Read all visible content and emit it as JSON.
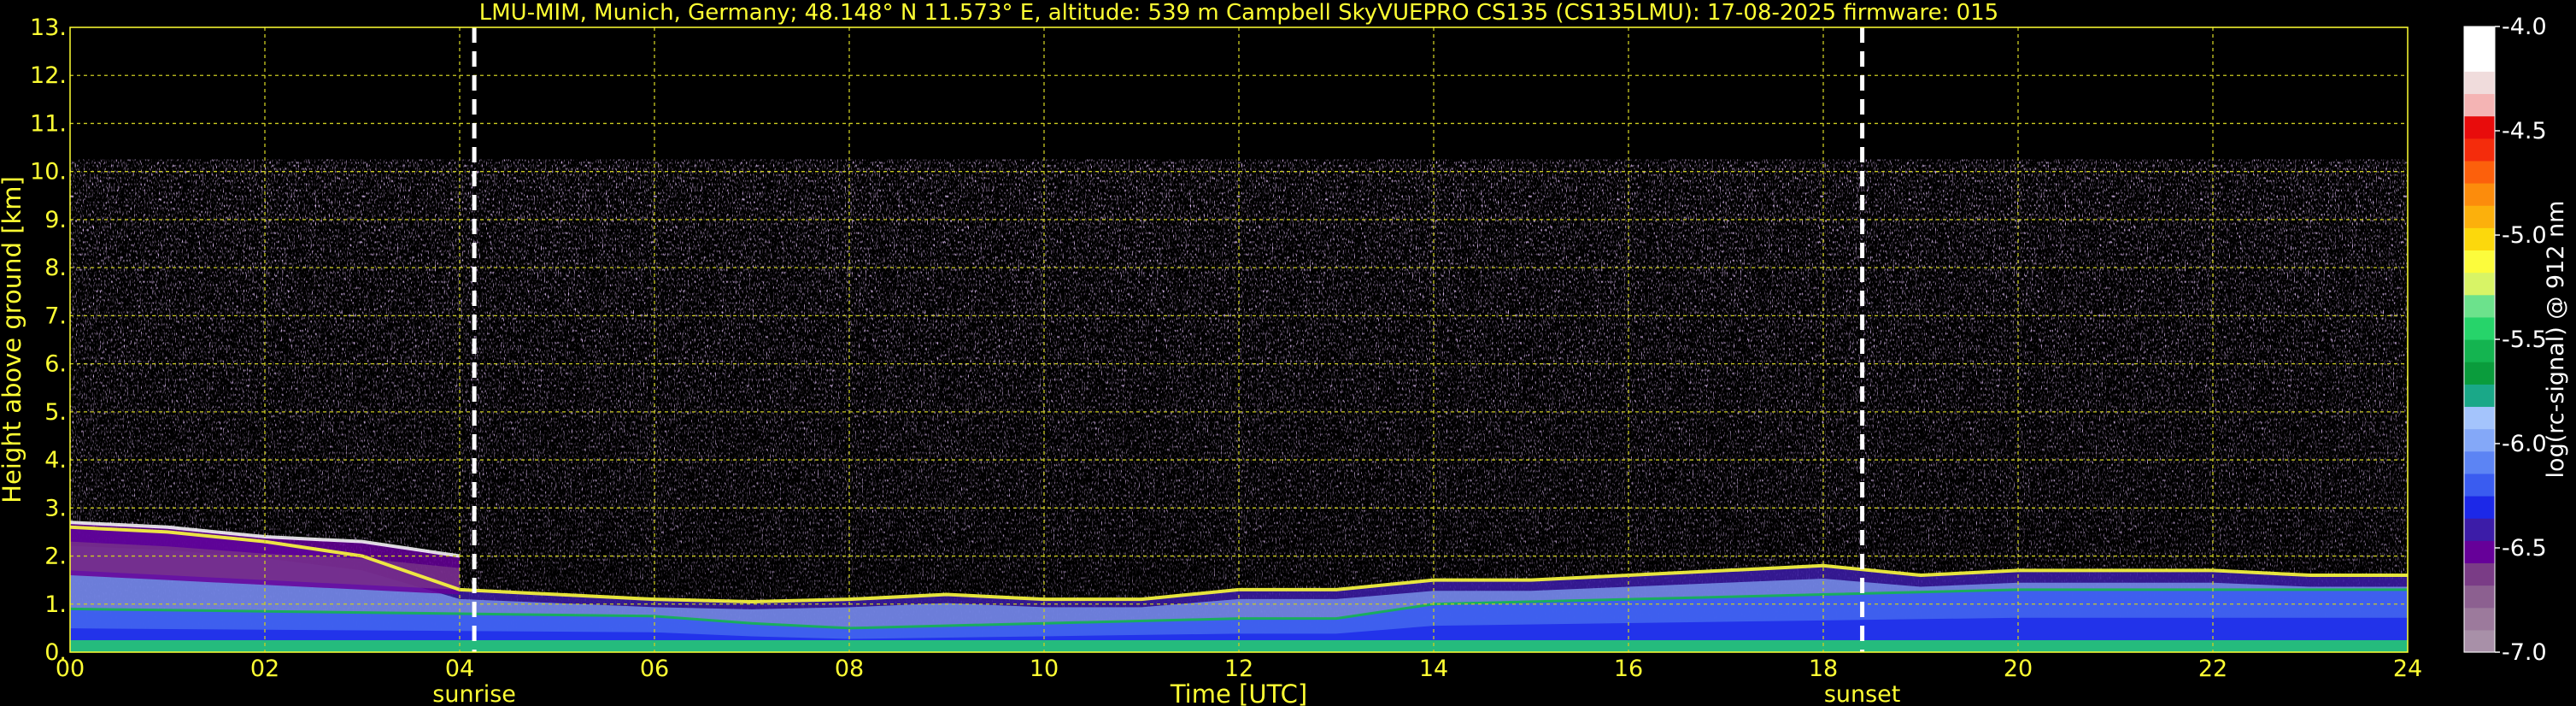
{
  "chart_data": {
    "type": "heatmap",
    "title": "LMU-MIM, Munich, Germany; 48.148° N 11.573° E, altitude: 539 m    Campbell SkyVUEPRO CS135 (CS135LMU): 17-08-2025    firmware: 015",
    "xlabel": "Time [UTC]",
    "ylabel": "Height above ground [km]",
    "xlim": [
      0,
      24
    ],
    "ylim": [
      0,
      13
    ],
    "x_ticks": [
      "00",
      "02",
      "04",
      "06",
      "08",
      "10",
      "12",
      "14",
      "16",
      "18",
      "20",
      "22",
      "24"
    ],
    "y_ticks": [
      "0.",
      "1.",
      "2.",
      "3.",
      "4.",
      "5.",
      "6.",
      "7.",
      "8.",
      "9.",
      "10.",
      "11.",
      "12.",
      "13."
    ],
    "grid": true,
    "signal_top_km": 10.25,
    "markers": [
      {
        "label": "sunrise",
        "time_utc": 4.15
      },
      {
        "label": "sunset",
        "time_utc": 18.4
      }
    ],
    "colorbar": {
      "label": "log(rc-signal) @ 912 nm",
      "range": [
        -7.0,
        -4.0
      ],
      "ticks": [
        "-4.0",
        "-4.5",
        "-5.0",
        "-5.5",
        "-6.0",
        "-6.5",
        "-7.0"
      ],
      "colors": [
        "#a890a8",
        "#9c7a9c",
        "#8c6090",
        "#7a3c86",
        "#660099",
        "#3c1ca8",
        "#1c28e8",
        "#3a5cf0",
        "#5c84f4",
        "#84a8f8",
        "#a4c4fc",
        "#1aa888",
        "#0a9c3c",
        "#14b450",
        "#26d46a",
        "#6ce28c",
        "#d8f466",
        "#fcfc3c",
        "#fcd80c",
        "#fcb00c",
        "#fc8c0c",
        "#fc600c",
        "#f42c0c",
        "#e80c0c",
        "#f4b4b4",
        "#f0dcdc",
        "#ffffff",
        "#ffffff"
      ]
    },
    "boundary_layer_top_km": {
      "time_utc": [
        0,
        1,
        2,
        3,
        4,
        5,
        6,
        7,
        8,
        9,
        10,
        11,
        12,
        13,
        14,
        15,
        16,
        17,
        18,
        19,
        20,
        21,
        22,
        23,
        24
      ],
      "height": [
        2.6,
        2.5,
        2.3,
        2.0,
        1.3,
        1.2,
        1.1,
        1.05,
        1.1,
        1.2,
        1.1,
        1.1,
        1.3,
        1.3,
        1.5,
        1.5,
        1.6,
        1.7,
        1.8,
        1.6,
        1.7,
        1.7,
        1.7,
        1.6,
        1.6
      ]
    },
    "residual_layer_km": {
      "time_utc": [
        0,
        1,
        2,
        3,
        4
      ],
      "top": [
        2.7,
        2.6,
        2.4,
        2.3,
        2.0
      ],
      "bottom": [
        1.6,
        1.5,
        1.4,
        1.3,
        1.2
      ]
    },
    "surface_layer_top_km": {
      "time_utc": [
        0,
        2,
        4,
        6,
        7,
        8,
        10,
        12,
        13,
        14,
        16,
        18,
        20,
        22,
        24
      ],
      "height": [
        0.9,
        0.85,
        0.8,
        0.75,
        0.6,
        0.5,
        0.6,
        0.7,
        0.7,
        1.0,
        1.1,
        1.2,
        1.3,
        1.3,
        1.3
      ]
    }
  }
}
